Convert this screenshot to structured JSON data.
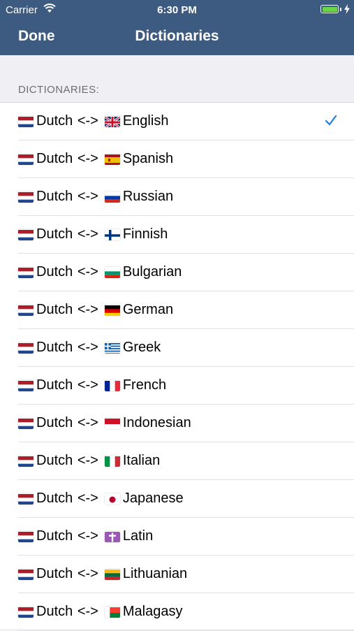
{
  "status": {
    "carrier": "Carrier",
    "time": "6:30 PM",
    "battery_level": 1.0
  },
  "nav": {
    "title": "Dictionaries",
    "done_label": "Done"
  },
  "section": {
    "header": "DICTIONARIES:"
  },
  "colors": {
    "nav_bg": "#3d5a80",
    "accent": "#1a7cf5",
    "group_bg": "#efeff4"
  },
  "source": {
    "label": "Dutch",
    "flag": "netherlands-flag",
    "separator": "<->"
  },
  "items": [
    {
      "label": "English",
      "flag": "uk-flag",
      "selected": true
    },
    {
      "label": "Spanish",
      "flag": "spain-flag",
      "selected": false
    },
    {
      "label": "Russian",
      "flag": "russia-flag",
      "selected": false
    },
    {
      "label": "Finnish",
      "flag": "finland-flag",
      "selected": false
    },
    {
      "label": "Bulgarian",
      "flag": "bulgaria-flag",
      "selected": false
    },
    {
      "label": "German",
      "flag": "germany-flag",
      "selected": false
    },
    {
      "label": "Greek",
      "flag": "greece-flag",
      "selected": false
    },
    {
      "label": "French",
      "flag": "france-flag",
      "selected": false
    },
    {
      "label": "Indonesian",
      "flag": "indonesia-flag",
      "selected": false
    },
    {
      "label": "Italian",
      "flag": "italy-flag",
      "selected": false
    },
    {
      "label": "Japanese",
      "flag": "japan-flag",
      "selected": false
    },
    {
      "label": "Latin",
      "flag": "latin-cross-icon",
      "selected": false
    },
    {
      "label": "Lithuanian",
      "flag": "lithuania-flag",
      "selected": false
    },
    {
      "label": "Malagasy",
      "flag": "madagascar-flag",
      "selected": false
    }
  ]
}
